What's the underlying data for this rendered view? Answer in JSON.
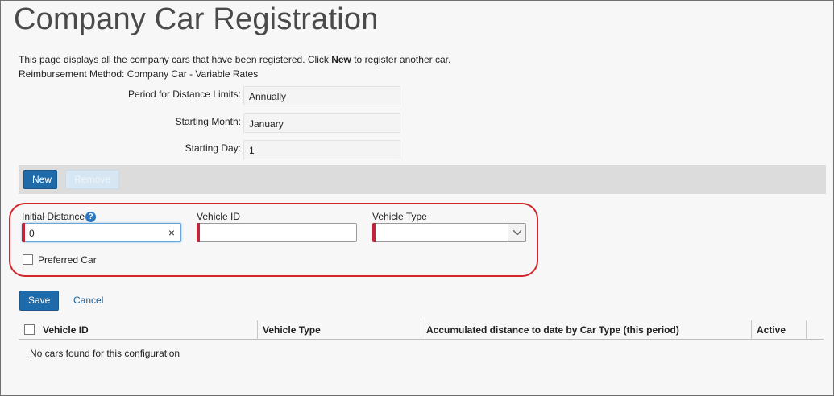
{
  "page": {
    "title": "Company Car Registration",
    "intro_before": "This page displays all the company cars that have been registered. Click ",
    "intro_bold": "New",
    "intro_after": " to register another car.",
    "reimbursement": "Reimbursement Method: Company Car - Variable Rates"
  },
  "settings": {
    "period_label": "Period for Distance Limits:",
    "period_value": "Annually",
    "month_label": "Starting Month:",
    "month_value": "January",
    "day_label": "Starting Day:",
    "day_value": "1"
  },
  "toolbar": {
    "new_label": "New",
    "remove_label": "Remove"
  },
  "form": {
    "initial_distance_label": "Initial Distance",
    "initial_distance_value": "0",
    "vehicle_id_label": "Vehicle ID",
    "vehicle_id_value": "",
    "vehicle_type_label": "Vehicle Type",
    "vehicle_type_value": "",
    "preferred_car_label": "Preferred Car",
    "preferred_car_checked": false,
    "help_icon": "question-mark-icon",
    "clear_icon": "×",
    "required_color": "#c0263a"
  },
  "actions": {
    "save_label": "Save",
    "cancel_label": "Cancel"
  },
  "table": {
    "columns": [
      "Vehicle ID",
      "Vehicle Type",
      "Accumulated distance to date by Car Type (this period)",
      "Active"
    ],
    "empty_message": "No cars found for this configuration"
  },
  "colors": {
    "primary": "#1f6aa8",
    "highlight": "#d4252a",
    "toolbar": "#dcdcdc"
  }
}
